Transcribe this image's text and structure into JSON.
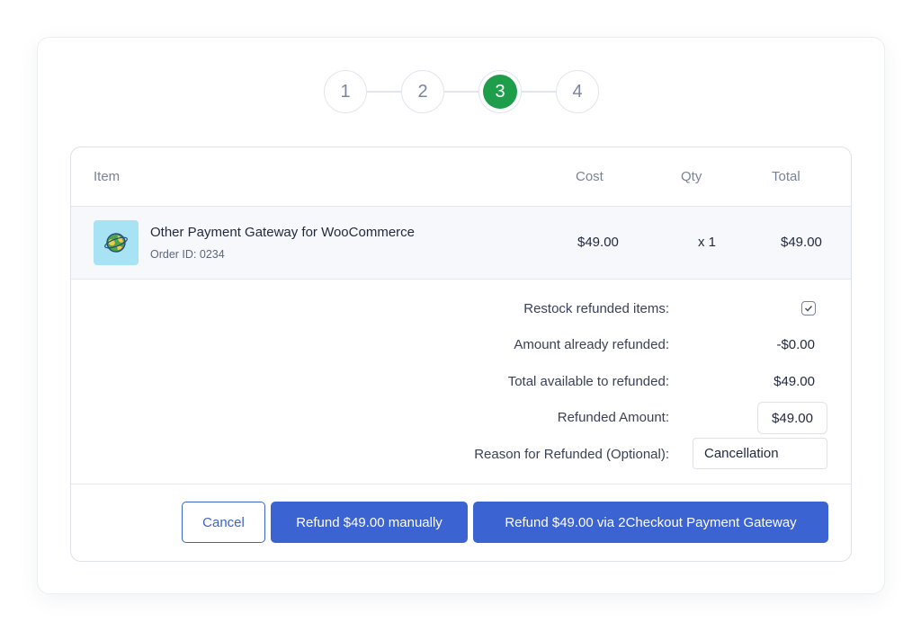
{
  "stepper": {
    "steps": [
      "1",
      "2",
      "3",
      "4"
    ],
    "active_step": "3",
    "active_color": "#1e9e4a"
  },
  "table": {
    "headers": {
      "item": "Item",
      "cost": "Cost",
      "qty": "Qty",
      "total": "Total"
    },
    "row": {
      "icon": "globe-icon",
      "name": "Other Payment Gateway for WooCommerce",
      "order_id": "Order ID: 0234",
      "cost": "$49.00",
      "qty": "x 1",
      "total": "$49.00"
    }
  },
  "summary": {
    "restock_label": "Restock refunded items:",
    "restock_checked": true,
    "already_refunded_label": "Amount already refunded:",
    "already_refunded_value": "-$0.00",
    "available_label": "Total available to refunded:",
    "available_value": "$49.00",
    "refund_amount_label": "Refunded Amount:",
    "refund_amount_value": "$49.00",
    "reason_label": "Reason for Refunded (Optional):",
    "reason_value": "Cancellation"
  },
  "actions": {
    "cancel_label": "Cancel",
    "manual_label": "Refund $49.00 manually",
    "gateway_label": "Refund $49.00 via 2Checkout Payment Gateway",
    "primary_color": "#3b63d1"
  }
}
